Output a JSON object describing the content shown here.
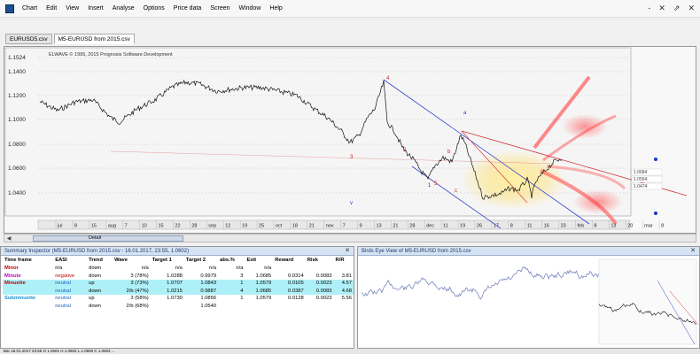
{
  "menubar": {
    "items": [
      "Chart",
      "Edit",
      "View",
      "Insert",
      "Analyse",
      "Options",
      "Price data",
      "Screen",
      "Window",
      "Help"
    ],
    "window_controls": [
      "-",
      "✕",
      "⇗",
      "✕"
    ]
  },
  "tabs": [
    {
      "label": "EURUSD5.csv",
      "active": false
    },
    {
      "label": "M5-EURUSD from 2015.csv",
      "active": true
    }
  ],
  "chart": {
    "copyright": "ELWAVE © 1995, 2015 Prognosis Software Development",
    "y_ticks": [
      "1.1524",
      "1.1400",
      "1.1200",
      "1.1000",
      "1.0800",
      "1.0600",
      "1.0400"
    ],
    "x_ticks": [
      "jul",
      "8",
      "15",
      "aug",
      "7",
      "10",
      "15",
      "22",
      "28",
      "sep",
      "12",
      "19",
      "25",
      "oct",
      "18",
      "21",
      "nov",
      "7",
      "9",
      "13",
      "21",
      "28",
      "dec",
      "11",
      "19",
      "26",
      "17",
      "8",
      "11",
      "16",
      "23",
      "feb",
      "8",
      "13",
      "20",
      "mar",
      "8"
    ],
    "wave_labels": [
      "4",
      "2",
      "1",
      "3",
      "5",
      "v",
      "a",
      "b",
      "c"
    ],
    "right_labels": [
      "1.0684",
      "1.0554",
      "1.0474"
    ],
    "accent_red": "#d42020",
    "accent_blue": "#1a35c8"
  },
  "scroll": {
    "detail_label": "Detail"
  },
  "summary": {
    "title": "Summary Inspector (M5-EURUSD from 2015.csv - 16.01.2017, 23:55, 1.0602)",
    "columns": [
      "Time frame",
      "EASI",
      "Trend",
      "Wave",
      "Target 1",
      "Target 2",
      "abs.%",
      "Exit",
      "Reward",
      "Risk",
      "R/R"
    ],
    "rows": [
      {
        "tf": "Minor",
        "easi": "n/a",
        "trend": "down",
        "wave": "n/a",
        "t1": "n/a",
        "t2": "n/a",
        "abs": "n/a",
        "exit": "n/a",
        "reward": "",
        "risk": "",
        "rr": "",
        "tf_color": "#c00000",
        "highlight": false
      },
      {
        "tf": "Minute",
        "easi": "negative",
        "trend": "down",
        "wave": "3 (78%)",
        "t1": "1.0288",
        "t2": "0.9979",
        "abs": "3",
        "exit": "1.0685",
        "reward": "0.0314",
        "risk": "0.0083",
        "rr": "3.81",
        "tf_color": "#c000c0",
        "easi_color": "#c00000",
        "highlight": false
      },
      {
        "tf": "Minuette",
        "easi": "neutral",
        "trend": "up",
        "wave": "3 (73%)",
        "t1": "1.0707",
        "t2": "1.0843",
        "abs": "1",
        "exit": "1.0579",
        "reward": "0.0105",
        "risk": "0.0023",
        "rr": "4.57",
        "tf_color": "#c00000",
        "easi_color": "#2060c0",
        "highlight": true
      },
      {
        "tf": "",
        "easi": "neutral",
        "trend": "down",
        "wave": "2/b (47%)",
        "t1": "1.0215",
        "t2": "0.9887",
        "abs": "4",
        "exit": "1.0685",
        "reward": "0.0387",
        "risk": "0.0083",
        "rr": "4.68",
        "tf_color": "#000",
        "easi_color": "#2060c0",
        "highlight": true
      },
      {
        "tf": "Subminuette",
        "easi": "neutral",
        "trend": "up",
        "wave": "3 (58%)",
        "t1": "1.0730",
        "t2": "1.0856",
        "abs": "1",
        "exit": "1.0579",
        "reward": "0.0128",
        "risk": "0.0023",
        "rr": "5.56",
        "tf_color": "#2090d0",
        "easi_color": "#2060c0",
        "highlight": false
      },
      {
        "tf": "",
        "easi": "neutral",
        "trend": "down",
        "wave": "2/b (68%)",
        "t1": "",
        "t2": "1.0540",
        "abs": "",
        "exit": "",
        "reward": "",
        "risk": "",
        "rr": "",
        "tf_color": "#000",
        "easi_color": "#2060c0",
        "highlight": false
      }
    ]
  },
  "birdseye": {
    "title": "Birds Eye View of M5-EURUSD from 2015.csv"
  },
  "status": {
    "text": "Bar 16.01.2017 23:55  O 1.0601  H 1.0602  L 1.0600  C 1.0602  ..."
  }
}
